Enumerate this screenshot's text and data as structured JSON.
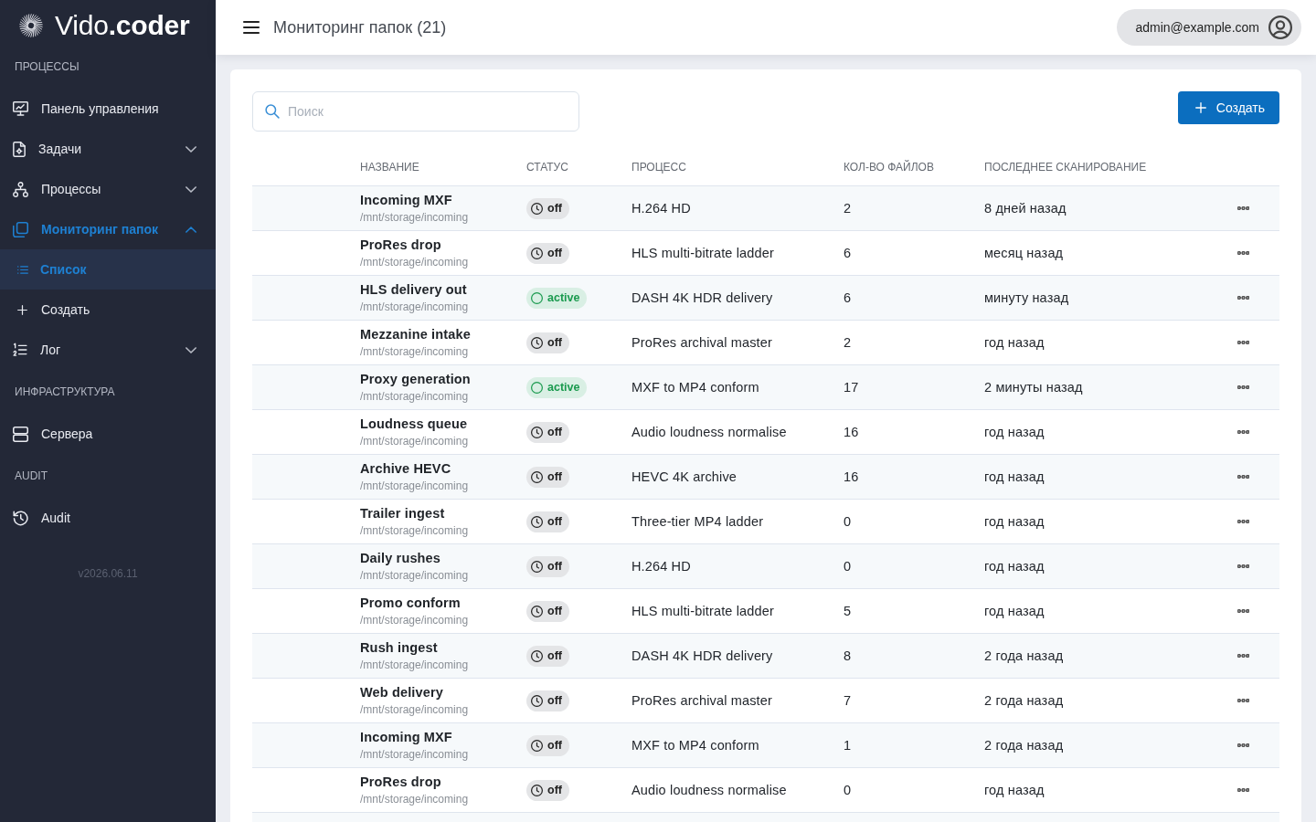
{
  "sidebar": {
    "logo": "Vido**.coder**",
    "sections": [
      {
        "label": "ПРОЦЕССЫ",
        "items": [
          {
            "kind": "link",
            "label": "Панель управления",
            "selected": false
          },
          {
            "kind": "group",
            "label": "Задачи",
            "selected": false,
            "expanded": false
          },
          {
            "kind": "group",
            "label": "Процессы",
            "selected": false,
            "expanded": false
          },
          {
            "kind": "group",
            "label": "Мониторинг папок",
            "selected": true,
            "expanded": true,
            "children": [
              {
                "kind": "link",
                "label": "Список",
                "selected": true
              },
              {
                "kind": "link",
                "label": "Создать",
                "selected": false
              }
            ]
          },
          {
            "kind": "group",
            "label": "Лог",
            "selected": false,
            "expanded": false
          }
        ]
      },
      {
        "label": "ИНФРАСТРУКТУРА",
        "items": [
          {
            "kind": "link",
            "label": "Сервера",
            "selected": false
          }
        ]
      },
      {
        "label": "AUDIT",
        "items": [
          {
            "kind": "link",
            "label": "Audit",
            "selected": false
          }
        ]
      }
    ],
    "version": "v2026.06.11"
  },
  "header": {
    "title": "Мониторинг папок (21)",
    "user": "admin@example.com"
  },
  "toolbar": {
    "search": {
      "placeholder": "Поиск"
    },
    "create_button": "Создать"
  },
  "table": {
    "columns": [
      "НАЗВАНИЕ",
      "СТАТУС",
      "ПРОЦЕСС",
      "КОЛ-ВО ФАЙЛОВ",
      "ПОСЛЕДНЕЕ СКАНИРОВАНИЕ"
    ],
    "rows": [
      {
        "name": "Incoming MXF",
        "path": "/mnt/storage/incoming",
        "status": {
          "label": "off",
          "on": false
        },
        "process": "H.264 HD",
        "files": "2",
        "last_scan": "8 дней назад"
      },
      {
        "name": "ProRes drop",
        "path": "/mnt/storage/incoming",
        "status": {
          "label": "off",
          "on": false
        },
        "process": "HLS multi-bitrate ladder",
        "files": "6",
        "last_scan": "месяц назад"
      },
      {
        "name": "HLS delivery out",
        "path": "/mnt/storage/incoming",
        "status": {
          "label": "active",
          "on": true
        },
        "process": "DASH 4K HDR delivery",
        "files": "6",
        "last_scan": "минуту назад"
      },
      {
        "name": "Mezzanine intake",
        "path": "/mnt/storage/incoming",
        "status": {
          "label": "off",
          "on": false
        },
        "process": "ProRes archival master",
        "files": "2",
        "last_scan": "год назад"
      },
      {
        "name": "Proxy generation",
        "path": "/mnt/storage/incoming",
        "status": {
          "label": "active",
          "on": true
        },
        "process": "MXF to MP4 conform",
        "files": "17",
        "last_scan": "2 минуты назад"
      },
      {
        "name": "Loudness queue",
        "path": "/mnt/storage/incoming",
        "status": {
          "label": "off",
          "on": false
        },
        "process": "Audio loudness normalise",
        "files": "16",
        "last_scan": "год назад"
      },
      {
        "name": "Archive HEVC",
        "path": "/mnt/storage/incoming",
        "status": {
          "label": "off",
          "on": false
        },
        "process": "HEVC 4K archive",
        "files": "16",
        "last_scan": "год назад"
      },
      {
        "name": "Trailer ingest",
        "path": "/mnt/storage/incoming",
        "status": {
          "label": "off",
          "on": false
        },
        "process": "Three-tier MP4 ladder",
        "files": "0",
        "last_scan": "год назад"
      },
      {
        "name": "Daily rushes",
        "path": "/mnt/storage/incoming",
        "status": {
          "label": "off",
          "on": false
        },
        "process": "H.264 HD",
        "files": "0",
        "last_scan": "год назад"
      },
      {
        "name": "Promo conform",
        "path": "/mnt/storage/incoming",
        "status": {
          "label": "off",
          "on": false
        },
        "process": "HLS multi-bitrate ladder",
        "files": "5",
        "last_scan": "год назад"
      },
      {
        "name": "Rush ingest",
        "path": "/mnt/storage/incoming",
        "status": {
          "label": "off",
          "on": false
        },
        "process": "DASH 4K HDR delivery",
        "files": "8",
        "last_scan": "2 года назад"
      },
      {
        "name": "Web delivery",
        "path": "/mnt/storage/incoming",
        "status": {
          "label": "off",
          "on": false
        },
        "process": "ProRes archival master",
        "files": "7",
        "last_scan": "2 года назад"
      },
      {
        "name": "Incoming MXF",
        "path": "/mnt/storage/incoming",
        "status": {
          "label": "off",
          "on": false
        },
        "process": "MXF to MP4 conform",
        "files": "1",
        "last_scan": "2 года назад"
      },
      {
        "name": "ProRes drop",
        "path": "/mnt/storage/incoming",
        "status": {
          "label": "off",
          "on": false
        },
        "process": "Audio loudness normalise",
        "files": "0",
        "last_scan": "год назад"
      }
    ]
  }
}
